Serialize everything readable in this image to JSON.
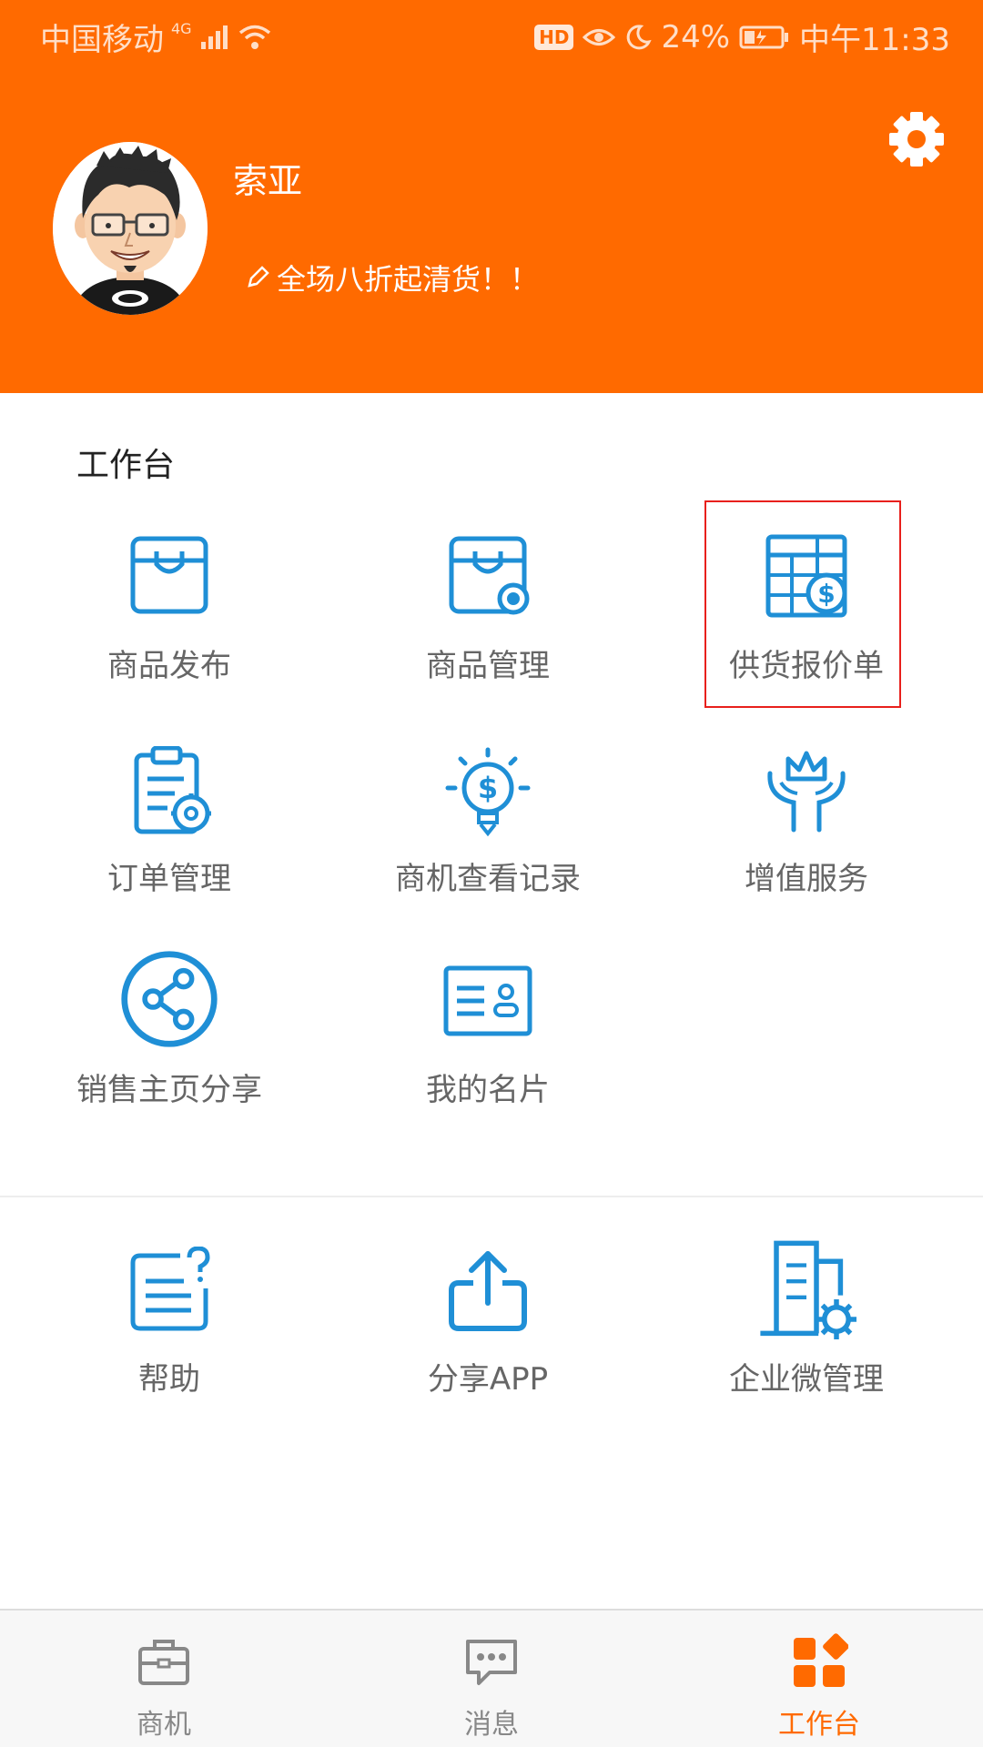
{
  "status_bar": {
    "carrier": "中国移动",
    "network": "4G",
    "hd": "HD",
    "battery": "24%",
    "time": "中午11:33"
  },
  "profile": {
    "name": "索亚",
    "slogan": "全场八折起清货！！"
  },
  "workbench": {
    "title": "工作台",
    "items": [
      {
        "label": "商品发布",
        "icon": "shopping-bag-icon"
      },
      {
        "label": "商品管理",
        "icon": "shopping-bag-manage-icon"
      },
      {
        "label": "供货报价单",
        "icon": "price-sheet-icon",
        "highlighted": true
      },
      {
        "label": "订单管理",
        "icon": "clipboard-gear-icon"
      },
      {
        "label": "商机查看记录",
        "icon": "dollar-bulb-icon"
      },
      {
        "label": "增值服务",
        "icon": "crown-hands-icon"
      },
      {
        "label": "销售主页分享",
        "icon": "share-circle-icon"
      },
      {
        "label": "我的名片",
        "icon": "business-card-icon"
      }
    ]
  },
  "tools": {
    "items": [
      {
        "label": "帮助",
        "icon": "help-document-icon"
      },
      {
        "label": "分享APP",
        "icon": "upload-share-icon"
      },
      {
        "label": "企业微管理",
        "icon": "building-gear-icon"
      }
    ]
  },
  "tabbar": {
    "items": [
      {
        "label": "商机",
        "icon": "briefcase-icon",
        "active": false
      },
      {
        "label": "消息",
        "icon": "chat-bubble-icon",
        "active": false
      },
      {
        "label": "工作台",
        "icon": "workbench-grid-icon",
        "active": true
      }
    ]
  },
  "colors": {
    "accent": "#ff6a00",
    "icon_blue": "#1f8fd6",
    "highlight_border": "#e8201c",
    "label_gray": "#666666"
  }
}
